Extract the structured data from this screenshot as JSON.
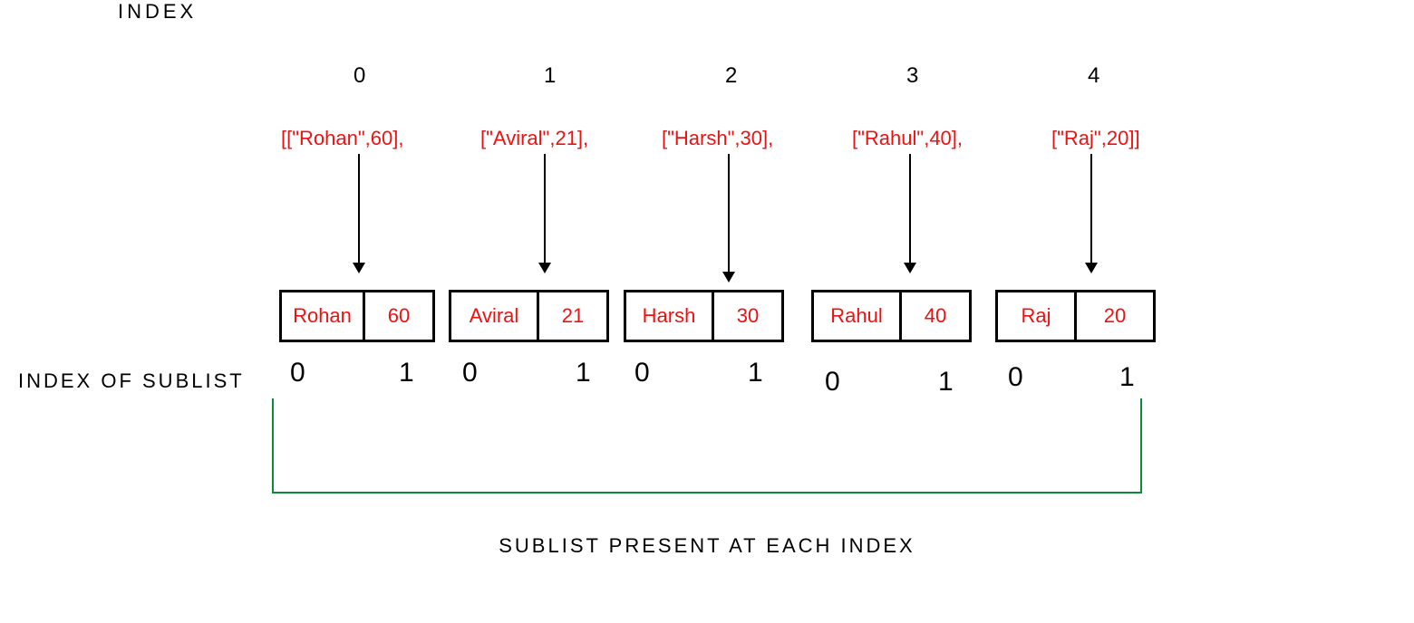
{
  "labels": {
    "index": "INDEX",
    "sublist_index": "INDEX OF SUBLIST",
    "caption": "SUBLIST PRESENT AT EACH INDEX"
  },
  "columns": [
    {
      "index": "0",
      "literal": "[[\"Rohan\",60],",
      "name": "Rohan",
      "value": "60",
      "sub0": "0",
      "sub1": "1"
    },
    {
      "index": "1",
      "literal": "[\"Aviral\",21],",
      "name": "Aviral",
      "value": "21",
      "sub0": "0",
      "sub1": "1"
    },
    {
      "index": "2",
      "literal": "[\"Harsh\",30],",
      "name": "Harsh",
      "value": "30",
      "sub0": "0",
      "sub1": "1"
    },
    {
      "index": "3",
      "literal": "[\"Rahul\",40],",
      "name": "Rahul",
      "value": "40",
      "sub0": "0",
      "sub1": "1"
    },
    {
      "index": "4",
      "literal": "[\"Raj\",20]]",
      "name": "Raj",
      "value": "20",
      "sub0": "0",
      "sub1": "1"
    }
  ]
}
